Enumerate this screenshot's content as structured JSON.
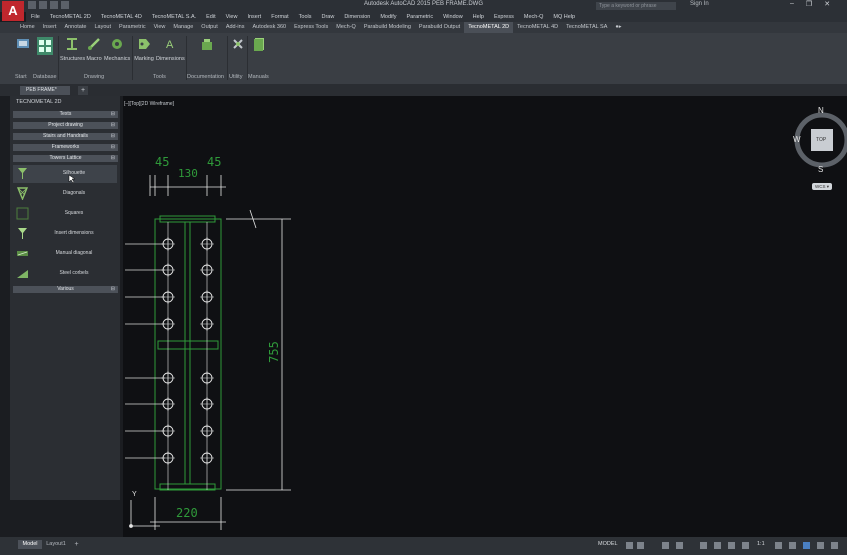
{
  "app": {
    "logo_letter": "A",
    "title": "Autodesk AutoCAD 2015    PEB FRAME.DWG",
    "search_placeholder": "Type a keyword or phrase",
    "sign_in": "Sign In",
    "window_controls": [
      "–",
      "❐",
      "✕"
    ]
  },
  "menubar": {
    "items": [
      "File",
      "TecnoMETAL 2D",
      "TecnoMETAL 4D",
      "TecnoMETAL S.A.",
      "Edit",
      "View",
      "Insert",
      "Format",
      "Tools",
      "Draw",
      "Dimension",
      "Modify",
      "Parametric",
      "Window",
      "Help",
      "Express",
      "Mech-Q",
      "MQ Help"
    ]
  },
  "ribbon_tabs": {
    "items": [
      "Home",
      "Insert",
      "Annotate",
      "Layout",
      "Parametric",
      "View",
      "Manage",
      "Output",
      "Add-ins",
      "Autodesk 360",
      "Express Tools",
      "Mech-Q",
      "Parabuild Modeling",
      "Parabuild Output",
      "TecnoMETAL 2D",
      "TecnoMETAL 4D",
      "TecnoMETAL SA",
      "●▸"
    ],
    "active": "TecnoMETAL 2D"
  },
  "ribbon": {
    "buttons": {
      "start": "Start",
      "database": "Database",
      "structures": "Structures",
      "macro": "Macro",
      "mechanics": "Mechanics",
      "marking": "Marking",
      "dimensions": "Dimensions",
      "documentation": "Documentation",
      "utility": "Utility",
      "manuals": "Manuals"
    },
    "groups": {
      "drawing": "Drawing",
      "tools": "Tools"
    }
  },
  "file_tabs": {
    "active": "PEB FRAME*",
    "add": "+"
  },
  "palette": {
    "title": "TECNOMETAL 2D",
    "categories": {
      "texts": "Texts",
      "project_drawing": "Project drawing",
      "stairs": "Stairs and Handrails",
      "frameworks": "Frameworks",
      "towers": "Towers Lattice",
      "various": "Various"
    },
    "collapse_glyph": "⊟",
    "tools": [
      "Silhouette",
      "Diagonals",
      "Squares",
      "Insert dimensions",
      "Manual diagonal",
      "Steel corbels"
    ]
  },
  "viewport": {
    "label": "[–][Top][2D Wireframe]",
    "viewcube": {
      "n": "N",
      "s": "S",
      "w": "W",
      "top": "TOP",
      "wcs": "WCS ▾"
    },
    "ucs_y": "Y",
    "dimensions": {
      "d45a": "45",
      "d45b": "45",
      "d130": "130",
      "d755": "755",
      "d220": "220"
    }
  },
  "statusbar": {
    "tabs": [
      "Model",
      "Layout1"
    ],
    "add_tab": "+",
    "model": "MODEL",
    "scale": "1:1"
  },
  "colors": {
    "drawing_green": "#2f9a3a",
    "drawing_white": "#e6e6e6",
    "accent_red": "#c0272d"
  }
}
